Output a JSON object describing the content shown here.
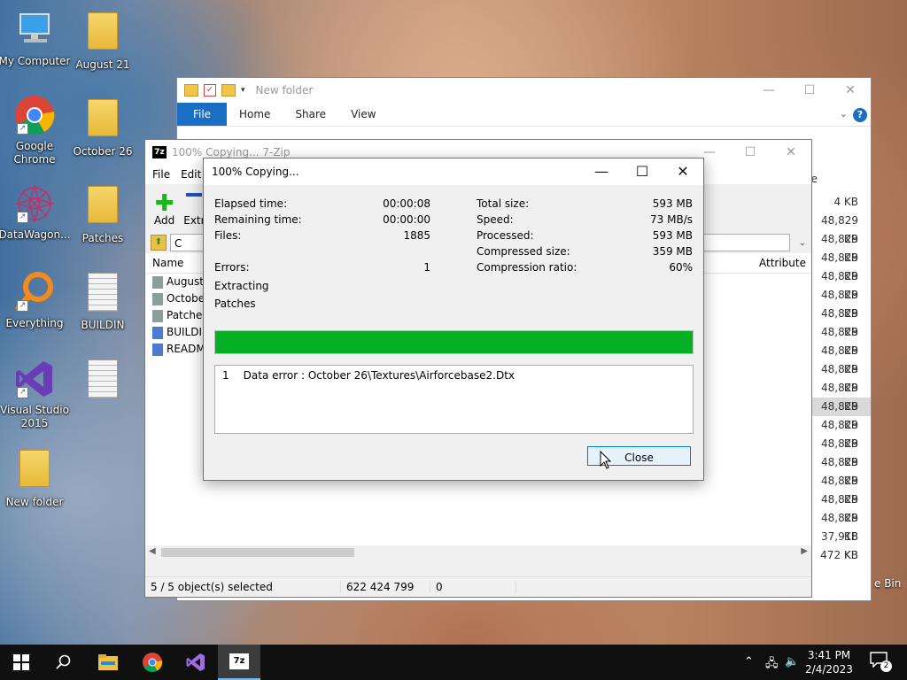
{
  "desktop": {
    "icons": [
      {
        "label": "My Computer",
        "kind": "computer"
      },
      {
        "label": "August 21",
        "kind": "folder"
      },
      {
        "label": "Google Chrome",
        "kind": "chrome"
      },
      {
        "label": "October 26",
        "kind": "folder"
      },
      {
        "label": "DataWagon...",
        "kind": "app"
      },
      {
        "label": "Patches",
        "kind": "folder"
      },
      {
        "label": "Everything",
        "kind": "search"
      },
      {
        "label": "BUILDIN",
        "kind": "doc"
      },
      {
        "label": "Visual Studio 2015",
        "kind": "vs"
      },
      {
        "label": "New folder",
        "kind": "folder"
      }
    ],
    "recycle_bin_label": "e Bin"
  },
  "explorer": {
    "title": "New folder",
    "ribbon_tabs": [
      "File",
      "Home",
      "Share",
      "View"
    ],
    "partial_column_letter": "e",
    "sizes": [
      "4 KB",
      "48,829 KB",
      "48,829 KB",
      "48,829 KB",
      "48,829 KB",
      "48,829 KB",
      "48,829 KB",
      "48,829 KB",
      "48,829 KB",
      "48,829 KB",
      "48,829 KB",
      "48,829 KB",
      "48,829 KB",
      "48,829 KB",
      "48,829 KB",
      "48,829 KB",
      "48,829 KB",
      "48,829 KB",
      "37,918 KB",
      "472 KB"
    ],
    "selected_size_index": 11
  },
  "zip_window": {
    "title": "100% Copying... 7-Zip",
    "logo": "7z",
    "menu": [
      "File",
      "Edit"
    ],
    "toolbar": {
      "add_label": "Add",
      "extract_label": "Extr"
    },
    "address_prefix": "C",
    "columns": {
      "name": "Name",
      "attributes": "Attribute"
    },
    "rows": [
      {
        "name": "August",
        "kind": "folder"
      },
      {
        "name": "Octobe",
        "kind": "folder"
      },
      {
        "name": "Patches",
        "kind": "folder"
      },
      {
        "name": "BUILDIN",
        "kind": "file"
      },
      {
        "name": "READM",
        "kind": "file"
      }
    ],
    "status": {
      "selected": "5 / 5 object(s) selected",
      "size": "622 424 799",
      "extra": "0"
    }
  },
  "dialog": {
    "title": "100% Copying...",
    "left_stats": [
      {
        "label": "Elapsed time:",
        "value": "00:00:08"
      },
      {
        "label": "Remaining time:",
        "value": "00:00:00"
      },
      {
        "label": "Files:",
        "value": "1885"
      }
    ],
    "errors": {
      "label": "Errors:",
      "value": "1"
    },
    "operation": "Extracting",
    "current_item": "Patches",
    "right_stats": [
      {
        "label": "Total size:",
        "value": "593 MB"
      },
      {
        "label": "Speed:",
        "value": "73 MB/s"
      },
      {
        "label": "Processed:",
        "value": "593 MB"
      },
      {
        "label": "Compressed size:",
        "value": "359 MB"
      },
      {
        "label": "Compression ratio:",
        "value": "60%"
      }
    ],
    "progress_fraction": 1.0,
    "progress_color": "#06b025",
    "messages": [
      {
        "index": "1",
        "text": "Data error : October 26\\Textures\\Airforcebase2.Dtx"
      }
    ],
    "close_label": "Close"
  },
  "taskbar": {
    "time": "3:41 PM",
    "date": "2/4/2023",
    "notification_count": "2",
    "pinned": [
      "windows-icon",
      "search-icon",
      "file-explorer-icon",
      "chrome-icon",
      "visual-studio-icon",
      "7zip-icon"
    ],
    "active": "7zip-icon"
  },
  "colors": {
    "accent": "#0078d7",
    "file_tab": "#1a6ec4",
    "taskbar": "#101010"
  }
}
